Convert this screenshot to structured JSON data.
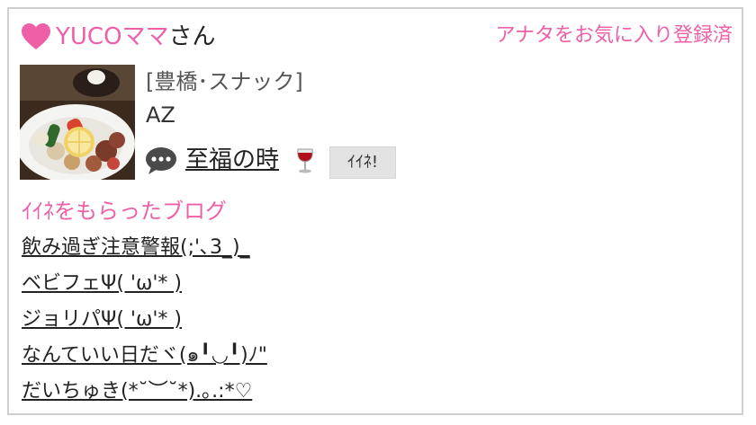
{
  "header": {
    "user_name": "YUCOママ",
    "user_suffix": "さん",
    "favorite_status": "アナタをお気に入り登録済"
  },
  "shop": {
    "category": "[豊橋･スナック]",
    "name": "AZ"
  },
  "post": {
    "title": "至福の時",
    "iine_label": "ｲｲﾈ!"
  },
  "liked_blogs": {
    "title": "ｲｲﾈをもらったブログ",
    "items": [
      {
        "label": "飲み過ぎ注意警報(;'､3_)_"
      },
      {
        "label": "ベビフェΨ( 'ω'* )"
      },
      {
        "label": "ジョリパΨ( 'ω'* )"
      },
      {
        "label": "なんていい日だヾ(๑╹◡╹)ﾉ\""
      },
      {
        "label": "だいちゅき(*˘︶˘*).｡.:*♡"
      }
    ]
  },
  "icons": {
    "heart": "heart-icon",
    "bubble": "speech-bubble-icon",
    "wine": "wine-glass-icon"
  },
  "colors": {
    "accent_pink": "#ee5fa7",
    "button_gray": "#e3e3e3"
  }
}
